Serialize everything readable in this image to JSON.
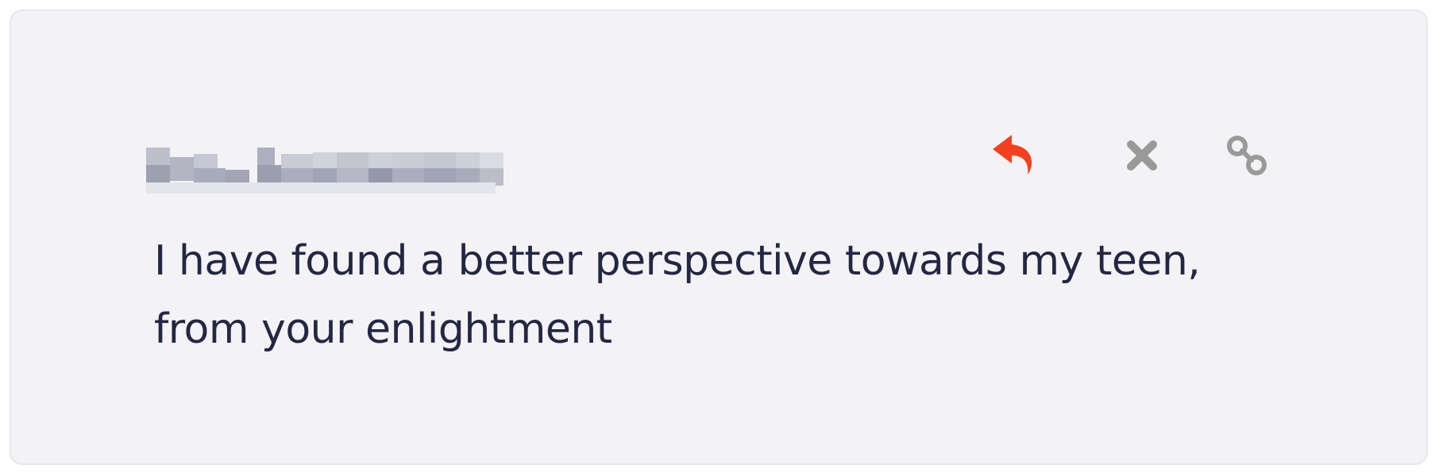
{
  "comment": {
    "author_name": "",
    "text": "I have found a better perspective towards my teen, from your enlightment",
    "actions": {
      "reply": {
        "icon": "reply-arrow-icon",
        "color": "#f5401f"
      },
      "delete": {
        "icon": "close-icon",
        "color": "#999999"
      },
      "link": {
        "icon": "link-chain-icon",
        "color": "#9a9a9a"
      }
    }
  }
}
